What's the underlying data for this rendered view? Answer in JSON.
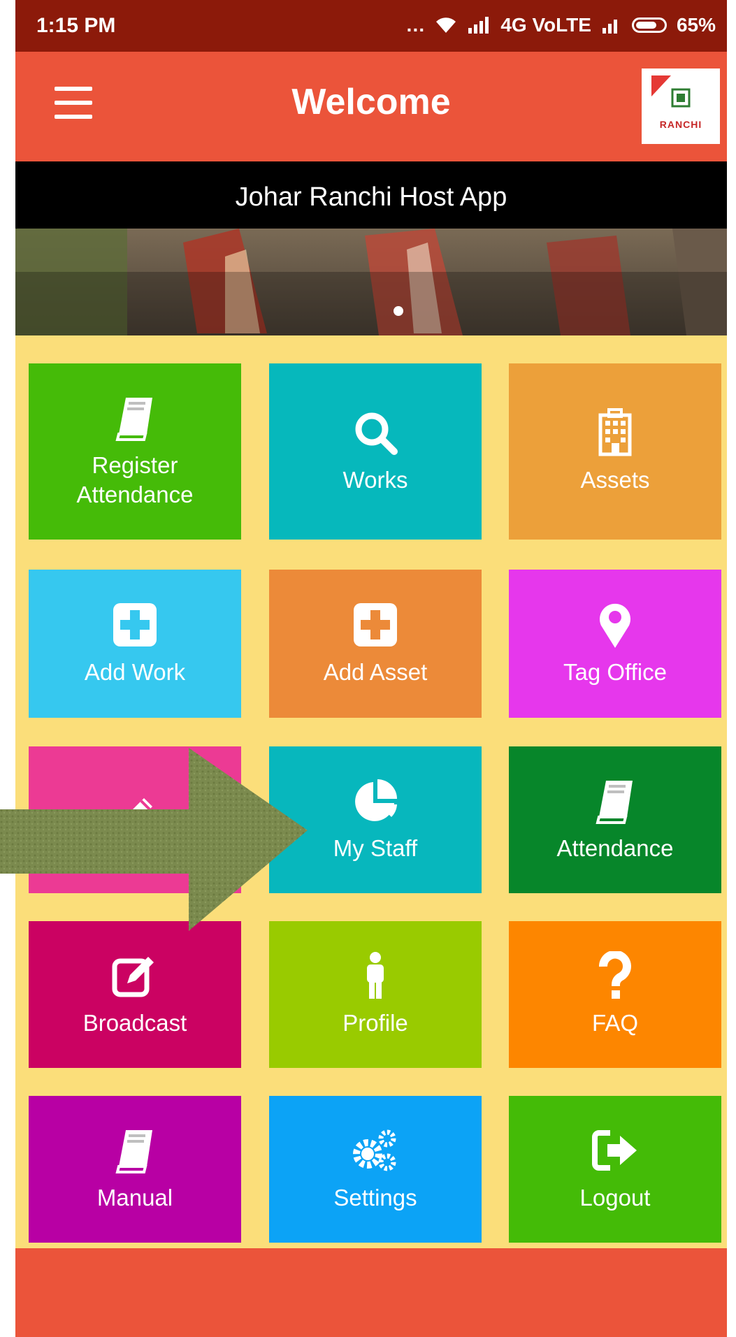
{
  "status_bar": {
    "time": "1:15 PM",
    "network": "4G VoLTE",
    "battery": "65%"
  },
  "toolbar": {
    "title": "Welcome",
    "logo_text": "RANCHI"
  },
  "banner": {
    "title": "Johar Ranchi Host App"
  },
  "tiles": [
    {
      "label": "Register\nAttendance",
      "icon": "book-icon",
      "color": "#45bb08"
    },
    {
      "label": "Works",
      "icon": "search-icon",
      "color": "#06b8bc"
    },
    {
      "label": "Assets",
      "icon": "building-icon",
      "color": "#eca03a"
    },
    {
      "label": "Add Work",
      "icon": "plus-square-icon",
      "color": "#36c8ef"
    },
    {
      "label": "Add Asset",
      "icon": "plus-square-icon",
      "color": "#ec8a39"
    },
    {
      "label": "Tag Office",
      "icon": "map-marker-icon",
      "color": "#e637ec"
    },
    {
      "label": "",
      "icon": "pencil-icon",
      "color": "#ec3a94"
    },
    {
      "label": "My Staff",
      "icon": "pie-chart-icon",
      "color": "#07b7bd"
    },
    {
      "label": "Attendance",
      "icon": "book-icon",
      "color": "#07862a"
    },
    {
      "label": "Broadcast",
      "icon": "edit-icon",
      "color": "#cb0262"
    },
    {
      "label": "Profile",
      "icon": "person-icon",
      "color": "#99cb00"
    },
    {
      "label": "FAQ",
      "icon": "question-icon",
      "color": "#fd8600"
    },
    {
      "label": "Manual",
      "icon": "book-icon",
      "color": "#b800a4"
    },
    {
      "label": "Settings",
      "icon": "gears-icon",
      "color": "#0ca3f6"
    },
    {
      "label": "Logout",
      "icon": "sign-out-icon",
      "color": "#44bb07"
    }
  ]
}
